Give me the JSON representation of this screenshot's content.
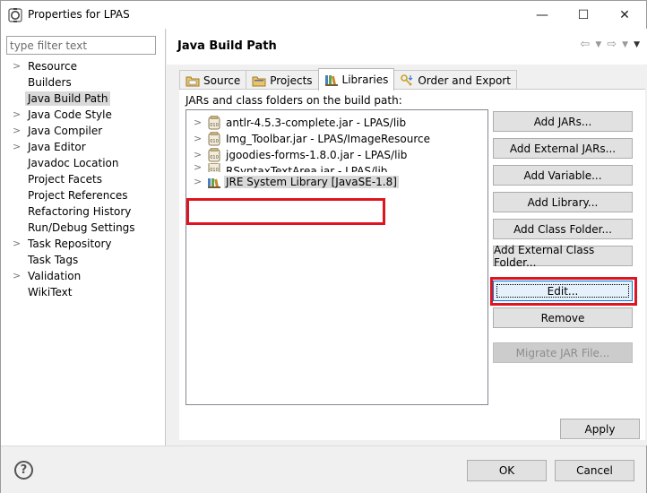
{
  "window": {
    "title": "Properties for LPAS",
    "minimize": "—",
    "maximize": "☐",
    "close": "✕"
  },
  "sidebar": {
    "filter_placeholder": "type filter text",
    "items": [
      {
        "label": "Resource",
        "expandable": true
      },
      {
        "label": "Builders",
        "expandable": false
      },
      {
        "label": "Java Build Path",
        "expandable": false,
        "selected": true
      },
      {
        "label": "Java Code Style",
        "expandable": true
      },
      {
        "label": "Java Compiler",
        "expandable": true
      },
      {
        "label": "Java Editor",
        "expandable": true
      },
      {
        "label": "Javadoc Location",
        "expandable": false
      },
      {
        "label": "Project Facets",
        "expandable": false
      },
      {
        "label": "Project References",
        "expandable": false
      },
      {
        "label": "Refactoring History",
        "expandable": false
      },
      {
        "label": "Run/Debug Settings",
        "expandable": false
      },
      {
        "label": "Task Repository",
        "expandable": true
      },
      {
        "label": "Task Tags",
        "expandable": false
      },
      {
        "label": "Validation",
        "expandable": true
      },
      {
        "label": "WikiText",
        "expandable": false
      }
    ]
  },
  "main": {
    "title": "Java Build Path",
    "tabs": [
      {
        "label": "Source",
        "icon": "source-folder-icon"
      },
      {
        "label": "Projects",
        "icon": "projects-icon"
      },
      {
        "label": "Libraries",
        "icon": "libraries-icon",
        "active": true
      },
      {
        "label": "Order and Export",
        "icon": "order-export-icon"
      }
    ],
    "jars_label": "JARs and class folders on the build path:",
    "jars": [
      {
        "label": "antlr-4.5.3-complete.jar - LPAS/lib",
        "icon": "jar-icon"
      },
      {
        "label": "Img_Toolbar.jar - LPAS/ImageResource",
        "icon": "jar-icon"
      },
      {
        "label": "jgoodies-forms-1.8.0.jar - LPAS/lib",
        "icon": "jar-icon"
      },
      {
        "label": "RSyntaxTextArea.jar - LPAS/lib",
        "icon": "jar-icon"
      },
      {
        "label": "JRE System Library [JavaSE-1.8]",
        "icon": "jre-library-icon",
        "selected": true
      }
    ],
    "buttons": {
      "add_jars": "Add JARs...",
      "add_external_jars": "Add External JARs...",
      "add_variable": "Add Variable...",
      "add_library": "Add Library...",
      "add_class_folder": "Add Class Folder...",
      "add_external_class_folder": "Add External Class Folder...",
      "edit": "Edit...",
      "remove": "Remove",
      "migrate_jar": "Migrate JAR File..."
    },
    "apply": "Apply"
  },
  "footer": {
    "help": "?",
    "ok": "OK",
    "cancel": "Cancel"
  },
  "colors": {
    "highlight": "#e0141e",
    "focus": "#0078d7"
  }
}
